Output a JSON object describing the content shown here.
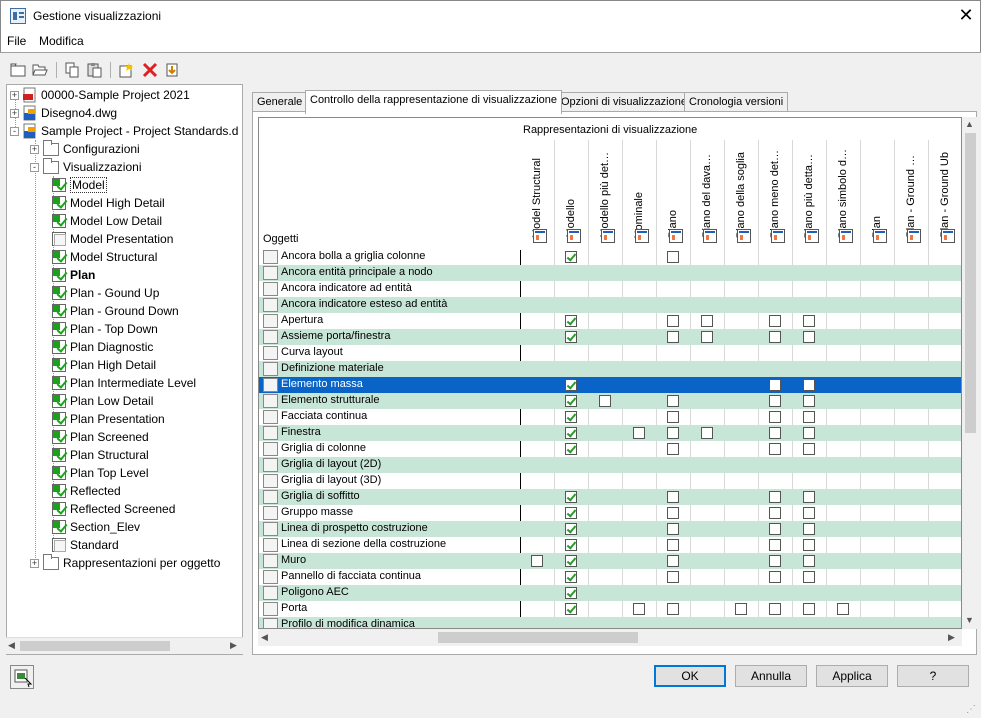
{
  "window": {
    "title": "Gestione visualizzazioni",
    "close_glyph": "✕"
  },
  "menu": [
    "File",
    "Modifica"
  ],
  "toolbar": [
    "new-icon",
    "open-icon",
    "copy-icon",
    "paste-icon",
    "new-display-icon",
    "delete-icon",
    "purge-icon"
  ],
  "tree": {
    "items": [
      {
        "label": "00000-Sample Project 2021",
        "icon": "pdf-icon",
        "exp": "+"
      },
      {
        "label": "Disegno4.dwg",
        "icon": "dwg-icon",
        "exp": "+"
      },
      {
        "label": "Sample Project - Project Standards.d",
        "icon": "dwg-icon",
        "exp": "-"
      },
      {
        "label": "Configurazioni",
        "icon": "folder-icon",
        "exp": "+"
      },
      {
        "label": "Visualizzazioni",
        "icon": "folder-open-icon",
        "exp": "-"
      },
      {
        "label": "Model",
        "check": true,
        "bold": false,
        "sel": true
      },
      {
        "label": "Model High Detail",
        "check": true
      },
      {
        "label": "Model Low Detail",
        "check": true
      },
      {
        "label": "Model Presentation",
        "check": false
      },
      {
        "label": "Model Structural",
        "check": true
      },
      {
        "label": "Plan",
        "check": true,
        "bold": true
      },
      {
        "label": "Plan - Gound Up",
        "check": true
      },
      {
        "label": "Plan - Ground Down",
        "check": true
      },
      {
        "label": "Plan - Top Down",
        "check": true
      },
      {
        "label": "Plan Diagnostic",
        "check": true
      },
      {
        "label": "Plan High Detail",
        "check": true
      },
      {
        "label": "Plan Intermediate Level",
        "check": true
      },
      {
        "label": "Plan Low Detail",
        "check": true
      },
      {
        "label": "Plan Presentation",
        "check": true
      },
      {
        "label": "Plan Screened",
        "check": true
      },
      {
        "label": "Plan Structural",
        "check": true
      },
      {
        "label": "Plan Top Level",
        "check": true
      },
      {
        "label": "Reflected",
        "check": true
      },
      {
        "label": "Reflected Screened",
        "check": true
      },
      {
        "label": "Section_Elev",
        "check": true
      },
      {
        "label": "Standard",
        "check": false
      },
      {
        "label": "Rappresentazioni per oggetto",
        "icon": "folder-icon",
        "exp": "+"
      }
    ]
  },
  "tabs": [
    "Generale",
    "Controllo della rappresentazione di visualizzazione",
    "Opzioni di visualizzazione",
    "Cronologia versioni"
  ],
  "grid": {
    "group_header": "Rappresentazioni di visualizzazione",
    "objects_header": "Oggetti",
    "columns": [
      "Model Structural",
      "Modello",
      "Modello più det…",
      "Nominale",
      "Piano",
      "Piano del dava…",
      "Piano della soglia",
      "Piano meno det…",
      "Piano più detta…",
      "Piano simbolo d…",
      "Plan",
      "Plan - Ground …",
      "Plan - Ground Ub"
    ],
    "rows": [
      {
        "label": "Ancora bolla a griglia colonne",
        "cells": [
          0,
          1,
          0,
          0,
          2,
          0,
          0,
          0,
          0,
          0,
          0,
          0,
          0
        ]
      },
      {
        "label": "Ancora entità principale a nodo",
        "cells": [
          0,
          0,
          0,
          0,
          0,
          0,
          0,
          0,
          0,
          0,
          0,
          0,
          0
        ]
      },
      {
        "label": "Ancora indicatore ad entità",
        "cells": [
          0,
          0,
          0,
          0,
          0,
          0,
          0,
          0,
          0,
          0,
          0,
          0,
          0
        ]
      },
      {
        "label": "Ancora indicatore esteso ad entità",
        "cells": [
          0,
          0,
          0,
          0,
          0,
          0,
          0,
          0,
          0,
          0,
          0,
          0,
          0
        ]
      },
      {
        "label": "Apertura",
        "cells": [
          0,
          1,
          0,
          0,
          2,
          2,
          0,
          2,
          2,
          0,
          0,
          0,
          0
        ]
      },
      {
        "label": "Assieme porta/finestra",
        "cells": [
          0,
          1,
          0,
          0,
          2,
          2,
          0,
          2,
          2,
          0,
          0,
          0,
          0
        ]
      },
      {
        "label": "Curva layout",
        "cells": [
          0,
          0,
          0,
          0,
          0,
          0,
          0,
          0,
          0,
          0,
          0,
          0,
          0
        ]
      },
      {
        "label": "Definizione materiale",
        "cells": [
          0,
          0,
          0,
          0,
          0,
          0,
          0,
          0,
          0,
          0,
          0,
          0,
          0
        ]
      },
      {
        "label": "Elemento massa",
        "cells": [
          0,
          1,
          0,
          0,
          0,
          0,
          0,
          2,
          2,
          0,
          0,
          0,
          0
        ]
      },
      {
        "label": "Elemento strutturale",
        "cells": [
          0,
          1,
          2,
          0,
          2,
          0,
          0,
          2,
          2,
          0,
          0,
          0,
          0
        ]
      },
      {
        "label": "Facciata continua",
        "cells": [
          0,
          1,
          0,
          0,
          2,
          0,
          0,
          2,
          2,
          0,
          0,
          0,
          0
        ]
      },
      {
        "label": "Finestra",
        "cells": [
          0,
          1,
          0,
          2,
          2,
          2,
          0,
          2,
          2,
          0,
          0,
          0,
          0
        ]
      },
      {
        "label": "Griglia di colonne",
        "cells": [
          0,
          1,
          0,
          0,
          2,
          0,
          0,
          2,
          2,
          0,
          0,
          0,
          0
        ]
      },
      {
        "label": "Griglia di layout (2D)",
        "cells": [
          0,
          0,
          0,
          0,
          0,
          0,
          0,
          0,
          0,
          0,
          0,
          0,
          0
        ]
      },
      {
        "label": "Griglia di layout (3D)",
        "cells": [
          0,
          0,
          0,
          0,
          0,
          0,
          0,
          0,
          0,
          0,
          0,
          0,
          0
        ]
      },
      {
        "label": "Griglia di soffitto",
        "cells": [
          0,
          1,
          0,
          0,
          2,
          0,
          0,
          2,
          2,
          0,
          0,
          0,
          0
        ]
      },
      {
        "label": "Gruppo masse",
        "cells": [
          0,
          1,
          0,
          0,
          2,
          0,
          0,
          2,
          2,
          0,
          0,
          0,
          0
        ]
      },
      {
        "label": "Linea di prospetto costruzione",
        "cells": [
          0,
          1,
          0,
          0,
          2,
          0,
          0,
          2,
          2,
          0,
          0,
          0,
          0
        ]
      },
      {
        "label": "Linea di sezione della costruzione",
        "cells": [
          0,
          1,
          0,
          0,
          2,
          0,
          0,
          2,
          2,
          0,
          0,
          0,
          0
        ]
      },
      {
        "label": "Muro",
        "cells": [
          2,
          1,
          0,
          0,
          2,
          0,
          0,
          2,
          2,
          0,
          0,
          0,
          0
        ]
      },
      {
        "label": "Pannello di facciata continua",
        "cells": [
          0,
          1,
          0,
          0,
          2,
          0,
          0,
          2,
          2,
          0,
          0,
          0,
          0
        ]
      },
      {
        "label": "Poligono AEC",
        "cells": [
          0,
          1,
          0,
          0,
          0,
          0,
          0,
          0,
          0,
          0,
          0,
          0,
          0
        ]
      },
      {
        "label": "Porta",
        "cells": [
          0,
          1,
          0,
          2,
          2,
          0,
          2,
          2,
          2,
          2,
          0,
          0,
          0
        ]
      },
      {
        "label": "Profilo di modifica dinamica",
        "cells": [
          0,
          0,
          0,
          0,
          0,
          0,
          0,
          0,
          0,
          0,
          0,
          0,
          0
        ]
      }
    ],
    "selected_row": 8
  },
  "buttons": {
    "ok": "OK",
    "cancel": "Annulla",
    "apply": "Applica",
    "help": "?"
  },
  "colors": {
    "alt_row": "#c8e6d8",
    "selection": "#0a64c8",
    "check": "#2a9a2a"
  }
}
